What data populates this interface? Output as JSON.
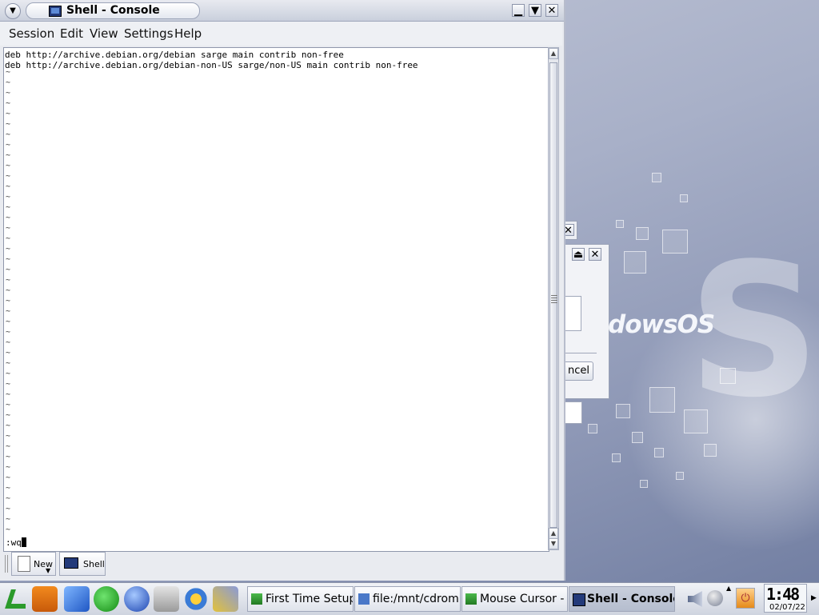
{
  "window": {
    "title": "Shell - Console",
    "menu_icon": "chevron-down-icon",
    "buttons": [
      "minimize-icon",
      "maximize-icon",
      "close-icon"
    ]
  },
  "menubar": {
    "items": [
      "Session",
      "Edit",
      "View",
      "Settings",
      "Help"
    ]
  },
  "terminal": {
    "lines": [
      "deb http://archive.debian.org/debian sarge main contrib non-free",
      "deb http://archive.debian.org/debian-non-US sarge/non-US main contrib non-free"
    ],
    "empty_line_marker": "~",
    "command": ":wq"
  },
  "session_tabs": {
    "new_label": "New",
    "shell_label": "Shell"
  },
  "desktop": {
    "logo_text": "dowsOS",
    "dialog_button_fragment": "ncel"
  },
  "taskbar": {
    "launchers": [
      "start-menu-icon",
      "lifejacket-icon",
      "cube-icon",
      "runner-icon",
      "globe-icon",
      "mailbox-icon",
      "people-icon",
      "pen-icon"
    ],
    "tasks": [
      {
        "label": "First Time Setup",
        "icon": "lindows-icon"
      },
      {
        "label": "file:/mnt/cdrom1",
        "icon": "folder-icon"
      },
      {
        "label": "Mouse Cursor -",
        "icon": "lindows-icon"
      },
      {
        "label": "Shell - Console",
        "icon": "terminal-icon",
        "active": true
      }
    ],
    "tray": [
      "speaker-icon",
      "network-icon",
      "power-icon"
    ],
    "clock_time": "1:48",
    "clock_date": "02/07/22"
  }
}
